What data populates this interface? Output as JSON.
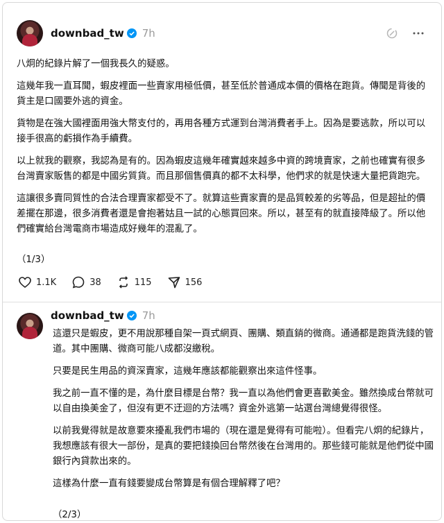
{
  "posts": [
    {
      "username": "downbad_tw",
      "time": "7h",
      "paragraphs": [
        "八炯的紀錄片解了一個我長久的疑惑。",
        "這幾年我一直耳聞，蝦皮裡面一些賣家用極低價，甚至低於普通成本價的價格在跑貨。傳聞是背後的貨主是口國要外逃的資金。",
        "貨物是在強大國裡面用強大幣支付的，再用各種方式運到台灣消費者手上。因為是要逃款，所以可以接手很高的虧損作為手續費。",
        "以上就我的觀察，我認為是有的。因為蝦皮這幾年確實越來越多中資的跨境賣家，之前也確實有很多台灣賣家販售的都是中國劣質貨。而且那個售價真的都不太科學，他們求的就是快速大量把貨跑完。",
        "這讓很多賣同質性的合法合理賣家都受不了。就算這些賣家賣的是品質較差的劣等品，但是超扯的價差擺在那邊，很多消費者還是會抱著姑且一試的心態買回來。所以，甚至有的就直接降級了。所以他們確實給台灣電商市場造成好幾年的混亂了。"
      ],
      "page": "（1/3）",
      "stats": {
        "likes": "1.1K",
        "replies": "38",
        "reposts": "115",
        "shares": "156"
      }
    },
    {
      "username": "downbad_tw",
      "time": "7h",
      "paragraphs": [
        "這還只是蝦皮，更不用說那種自架一頁式網頁、團購、類直銷的微商。通通都是跑貨洗錢的管道。其中團購、微商可能八成都沒繳稅。",
        "只要是民生用品的資深賣家，這幾年應該都能觀察出來這件怪事。",
        "我之前一直不懂的是，為什麼目標是台幣？我一直以為他們會更喜歡美金。雖然換成台幣就可以自由換美金了，但沒有更不迂迴的方法嗎？資金外逃第一站選台灣總覺得很怪。",
        "以前我覺得就是故意要來擾亂我們市場的（現在還是覺得有可能啦）。但看完八炯的紀錄片，我想應該有很大一部份，是真的要把錢換回台幣然後在台灣用的。那些錢可能就是他們從中國銀行內貸款出來的。",
        "這樣為什麼一直有錢要變成台幣算是有個合理解釋了吧？"
      ],
      "page": "（2/3）"
    }
  ],
  "colors": {
    "verified": "#0095f6",
    "muted": "#9a9a9a"
  },
  "icons": [
    "verified-badge-icon",
    "ghost-slash-icon",
    "more-icon",
    "heart-icon",
    "reply-icon",
    "repost-icon",
    "share-icon"
  ]
}
